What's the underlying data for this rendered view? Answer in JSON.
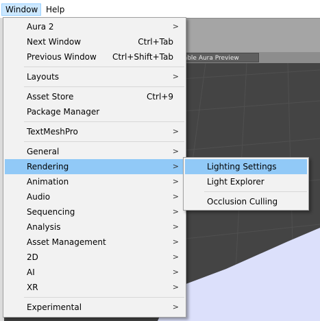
{
  "menubar": {
    "items": [
      {
        "label": "Window"
      },
      {
        "label": "Help"
      }
    ]
  },
  "scene": {
    "preview_tab_label": "sable Aura Preview"
  },
  "main_menu": {
    "items": [
      {
        "label": "Aura 2",
        "shortcut": "",
        "submenu": true
      },
      {
        "label": "Next Window",
        "shortcut": "Ctrl+Tab",
        "submenu": false
      },
      {
        "label": "Previous Window",
        "shortcut": "Ctrl+Shift+Tab",
        "submenu": false
      },
      {
        "label": "Layouts",
        "shortcut": "",
        "submenu": true
      },
      {
        "label": "Asset Store",
        "shortcut": "Ctrl+9",
        "submenu": false
      },
      {
        "label": "Package Manager",
        "shortcut": "",
        "submenu": false
      },
      {
        "label": "TextMeshPro",
        "shortcut": "",
        "submenu": true
      },
      {
        "label": "General",
        "shortcut": "",
        "submenu": true
      },
      {
        "label": "Rendering",
        "shortcut": "",
        "submenu": true
      },
      {
        "label": "Animation",
        "shortcut": "",
        "submenu": true
      },
      {
        "label": "Audio",
        "shortcut": "",
        "submenu": true
      },
      {
        "label": "Sequencing",
        "shortcut": "",
        "submenu": true
      },
      {
        "label": "Analysis",
        "shortcut": "",
        "submenu": true
      },
      {
        "label": "Asset Management",
        "shortcut": "",
        "submenu": true
      },
      {
        "label": "2D",
        "shortcut": "",
        "submenu": true
      },
      {
        "label": "AI",
        "shortcut": "",
        "submenu": true
      },
      {
        "label": "XR",
        "shortcut": "",
        "submenu": true
      },
      {
        "label": "Experimental",
        "shortcut": "",
        "submenu": true
      }
    ],
    "arrow_glyph": ">"
  },
  "rendering_submenu": {
    "items": [
      {
        "label": "Lighting Settings"
      },
      {
        "label": "Light Explorer"
      },
      {
        "label": "Occlusion Culling"
      }
    ]
  },
  "colors": {
    "highlight": "#91c9f7",
    "menu_bg": "#f2f2f2",
    "scene_floor": "#dce0fb"
  }
}
